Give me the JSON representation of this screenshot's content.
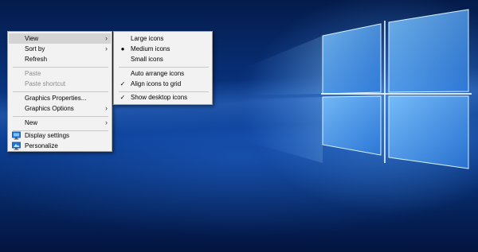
{
  "colors": {
    "menu_background": "#f2f2f2",
    "menu_highlight": "#d4d4d4",
    "disabled_text": "#8c8c8c",
    "desktop_blue": "#0a3b8f"
  },
  "context_menu": {
    "items": [
      {
        "label": "View",
        "submenu": true,
        "highlighted": true
      },
      {
        "label": "Sort by",
        "submenu": true
      },
      {
        "label": "Refresh"
      },
      {
        "label": "Paste",
        "disabled": true
      },
      {
        "label": "Paste shortcut",
        "disabled": true
      },
      {
        "label": "Graphics Properties..."
      },
      {
        "label": "Graphics Options",
        "submenu": true
      },
      {
        "label": "New",
        "submenu": true
      },
      {
        "label": "Display settings",
        "icon": "display-settings-icon"
      },
      {
        "label": "Personalize",
        "icon": "personalize-icon"
      }
    ]
  },
  "view_submenu": {
    "items": [
      {
        "label": "Large icons"
      },
      {
        "label": "Medium icons",
        "selected": true,
        "mark": "bullet"
      },
      {
        "label": "Small icons"
      },
      {
        "label": "Auto arrange icons"
      },
      {
        "label": "Align icons to grid",
        "checked": true,
        "mark": "check"
      },
      {
        "label": "Show desktop icons",
        "checked": true,
        "mark": "check"
      }
    ]
  }
}
